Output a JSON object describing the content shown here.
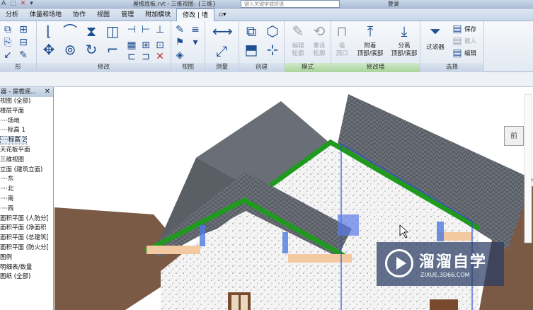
{
  "titlebar": {
    "title": "屋檐底板.rvt - 三维视图: {三维}",
    "search_placeholder": "键入关键字或短语",
    "login_label": "登录",
    "qat_glyphs": [
      "A",
      "⬚",
      "✕",
      "▾"
    ]
  },
  "tabs": [
    {
      "label": "分析",
      "active": false
    },
    {
      "label": "体量和场地",
      "active": false
    },
    {
      "label": "协作",
      "active": false
    },
    {
      "label": "视图",
      "active": false
    },
    {
      "label": "管理",
      "active": false
    },
    {
      "label": "附加模块",
      "active": false
    },
    {
      "label": "修改 | 墙",
      "active": true
    },
    {
      "label": "▫▾",
      "active": false
    }
  ],
  "ribbon": {
    "panels": {
      "p0": "形",
      "modify": "修改",
      "view": "视图",
      "measure": "测量",
      "create": "创建",
      "mode": "模式",
      "modify_wall": "修改墙",
      "select": "选择"
    },
    "buttons": {
      "edit_profile": "编辑\n轮廓",
      "reset_profile": "重设\n轮廓",
      "wall_opening": "墙\n洞口",
      "attach": "附着\n顶部/底部",
      "detach": "分离\n顶部/底部",
      "filter": "过滤器",
      "save": "保存",
      "load": "载入",
      "edit": "编辑"
    }
  },
  "browser": {
    "header": "器 - 屋檐底...",
    "close": "✕",
    "items": [
      {
        "label": "视图 (全部)",
        "selected": false
      },
      {
        "label": "楼层平面",
        "selected": false
      },
      {
        "label": "····场地",
        "selected": false
      },
      {
        "label": "····标高 1",
        "selected": false
      },
      {
        "label": "····标高 2",
        "selected": true
      },
      {
        "label": "天花板平面",
        "selected": false
      },
      {
        "label": "三维视图",
        "selected": false
      },
      {
        "label": "立面 (建筑立面)",
        "selected": false
      },
      {
        "label": "····东",
        "selected": false
      },
      {
        "label": "····北",
        "selected": false
      },
      {
        "label": "····南",
        "selected": false
      },
      {
        "label": "····西",
        "selected": false
      },
      {
        "label": "面积平面 (人防分[",
        "selected": false
      },
      {
        "label": "面积平面 (净面积",
        "selected": false
      },
      {
        "label": "面积平面 (总建筑[",
        "selected": false
      },
      {
        "label": "面积平面 (防火分[",
        "selected": false
      },
      {
        "label": "图例",
        "selected": false
      },
      {
        "label": "明细表/数量",
        "selected": false
      },
      {
        "label": "图纸 (全部)",
        "selected": false
      }
    ]
  },
  "viewcube_label": "前",
  "watermark": {
    "main": "溜溜自学",
    "sub": "ZIXUE.3D66.COM"
  },
  "colors": {
    "roof": "#5a5f66",
    "fascia": "#1f9a1f",
    "wall": "#f2f2f2",
    "ground": "#7a5a45",
    "selection": "#2a4fd6"
  }
}
